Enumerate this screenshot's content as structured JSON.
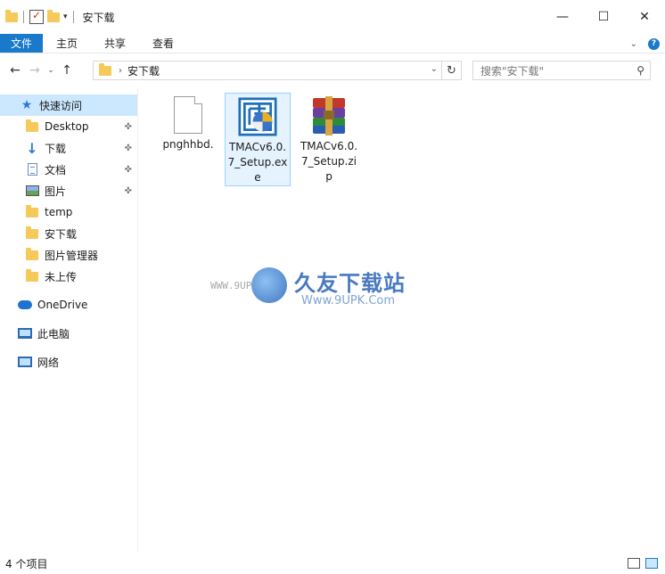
{
  "window": {
    "title": "安下载",
    "controls": {
      "minimize": "—",
      "maximize": "☐",
      "close": "✕"
    }
  },
  "ribbon": {
    "tabs": [
      "文件",
      "主页",
      "共享",
      "查看"
    ],
    "collapse_icon": "chevron-down-icon",
    "help_icon": "?"
  },
  "nav": {
    "back": "←",
    "forward": "→",
    "recent": "⌄",
    "up": "↑",
    "breadcrumb": "安下载",
    "search_placeholder": "搜索\"安下载\""
  },
  "sidebar": {
    "quick_access": "快速访问",
    "items": [
      {
        "label": "Desktop",
        "icon": "folder-icon",
        "pinned": true
      },
      {
        "label": "下载",
        "icon": "download-icon",
        "pinned": true
      },
      {
        "label": "文档",
        "icon": "document-icon",
        "pinned": true
      },
      {
        "label": "图片",
        "icon": "picture-icon",
        "pinned": true
      },
      {
        "label": "temp",
        "icon": "folder-icon",
        "pinned": false
      },
      {
        "label": "安下载",
        "icon": "folder-icon",
        "pinned": false
      },
      {
        "label": "图片管理器",
        "icon": "folder-icon",
        "pinned": false
      },
      {
        "label": "未上传",
        "icon": "folder-icon",
        "pinned": false
      }
    ],
    "onedrive": "OneDrive",
    "this_pc": "此电脑",
    "network": "网络"
  },
  "files": [
    {
      "name": "pnghhbd.",
      "icon": "blank-file-icon",
      "selected": false
    },
    {
      "name": "TMACv6.0.7_Setup.exe",
      "icon": "exe-installer-icon",
      "selected": true
    },
    {
      "name": "TMACv6.0.7_Setup.zip",
      "icon": "winrar-archive-icon",
      "selected": false
    }
  ],
  "watermark": {
    "brand": "久友下载站",
    "url": "Www.9UPK.Com",
    "side": "WWW.9UPK.COM"
  },
  "status": {
    "item_count": "4 个项目"
  },
  "colors": {
    "accent": "#1979ca",
    "selection": "#cce8ff",
    "folder": "#f5c95a"
  }
}
